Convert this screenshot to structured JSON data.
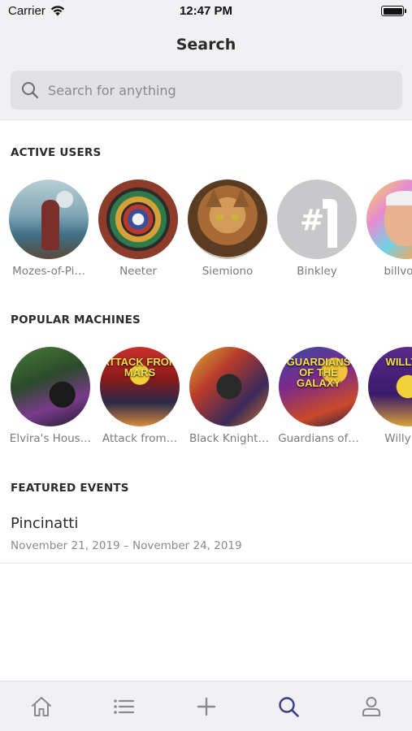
{
  "status_bar": {
    "carrier": "Carrier",
    "time": "12:47 PM"
  },
  "header": {
    "title": "Search"
  },
  "search": {
    "placeholder": "Search for anything",
    "value": ""
  },
  "active_users": {
    "title": "ACTIVE USERS",
    "items": [
      {
        "name": "Mozes-of-Pi…"
      },
      {
        "name": "Neeter"
      },
      {
        "name": "Siemiono"
      },
      {
        "name": "Binkley"
      },
      {
        "name": "billvolck"
      }
    ]
  },
  "popular_machines": {
    "title": "POPULAR MACHINES",
    "items": [
      {
        "name": "Elvira's Hous…"
      },
      {
        "name": "Attack from…",
        "art_text": "ATTACK FROM MARS"
      },
      {
        "name": "Black Knight…"
      },
      {
        "name": "Guardians of…",
        "art_text": "GUARDIANS OF THE GALAXY"
      },
      {
        "name": "Willy Wo",
        "art_text": "WILLY W"
      }
    ]
  },
  "featured_events": {
    "title": "FEATURED EVENTS",
    "items": [
      {
        "name": "Pincinatti",
        "dates": "November 21, 2019 – November 24, 2019"
      }
    ]
  },
  "tabbar": {
    "active": "search",
    "active_color": "#3b3b8f",
    "inactive_color": "#8a8a8e",
    "items": [
      {
        "id": "home",
        "icon": "home-icon"
      },
      {
        "id": "list",
        "icon": "list-icon"
      },
      {
        "id": "add",
        "icon": "plus-icon"
      },
      {
        "id": "search",
        "icon": "search-icon"
      },
      {
        "id": "profile",
        "icon": "person-icon"
      }
    ]
  }
}
